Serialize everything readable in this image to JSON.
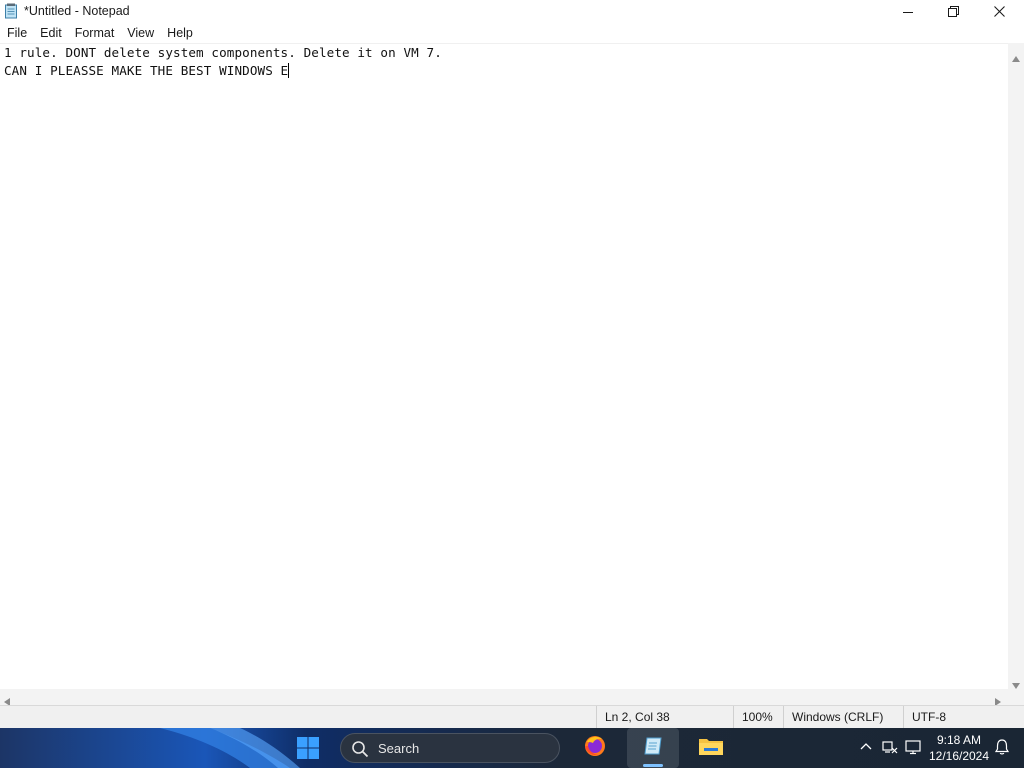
{
  "window": {
    "title": "*Untitled - Notepad",
    "app_icon": "notepad-icon"
  },
  "window_controls": {
    "minimize_icon": "minimize-icon",
    "maximize_icon": "restore-icon",
    "close_icon": "close-icon"
  },
  "menu": {
    "items": [
      "File",
      "Edit",
      "Format",
      "View",
      "Help"
    ]
  },
  "editor": {
    "lines": [
      "1 rule. DONT delete system components. Delete it on VM 7.",
      "CAN I PLEASSE MAKE THE BEST WINDOWS E"
    ]
  },
  "status": {
    "position": "Ln 2, Col 38",
    "zoom": "100%",
    "line_ending": "Windows (CRLF)",
    "encoding": "UTF-8"
  },
  "taskbar": {
    "search_label": "Search",
    "apps": [
      "firefox-icon",
      "notepad-icon",
      "file-explorer-icon"
    ],
    "tray_icons": [
      "chevron-up-icon",
      "network-icon",
      "display-icon",
      "notification-bell-icon"
    ],
    "clock": {
      "time": "9:18 AM",
      "date": "12/16/2024"
    }
  },
  "colors": {
    "taskbar_bg": "#1b2a3c",
    "status_bg": "#f0f0f0",
    "accent": "#0078d4"
  }
}
